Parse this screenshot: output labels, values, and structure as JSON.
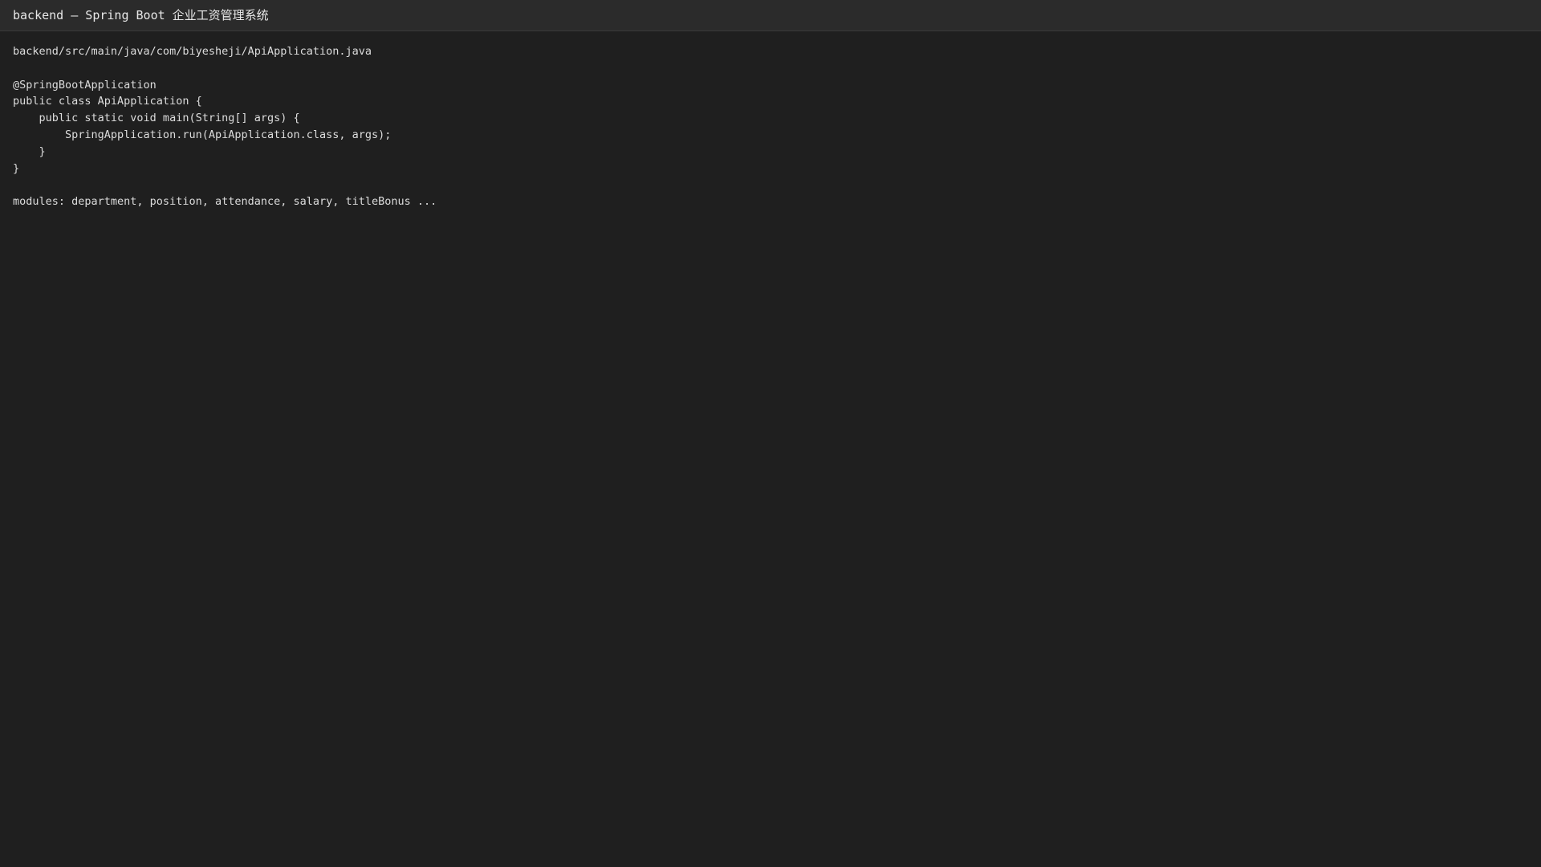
{
  "window": {
    "title": "backend — Spring Boot 企业工资管理系统"
  },
  "editor": {
    "file_path": "backend/src/main/java/com/biyesheji/ApiApplication.java",
    "code_lines": [
      "@SpringBootApplication",
      "public class ApiApplication {",
      "    public static void main(String[] args) {",
      "        SpringApplication.run(ApiApplication.class, args);",
      "    }",
      "}"
    ],
    "modules_line": "modules: department, position, attendance, salary, titleBonus ..."
  },
  "colors": {
    "background": "#1f1f1f",
    "titlebar": "#2b2b2b",
    "text": "#dcdcdc"
  }
}
